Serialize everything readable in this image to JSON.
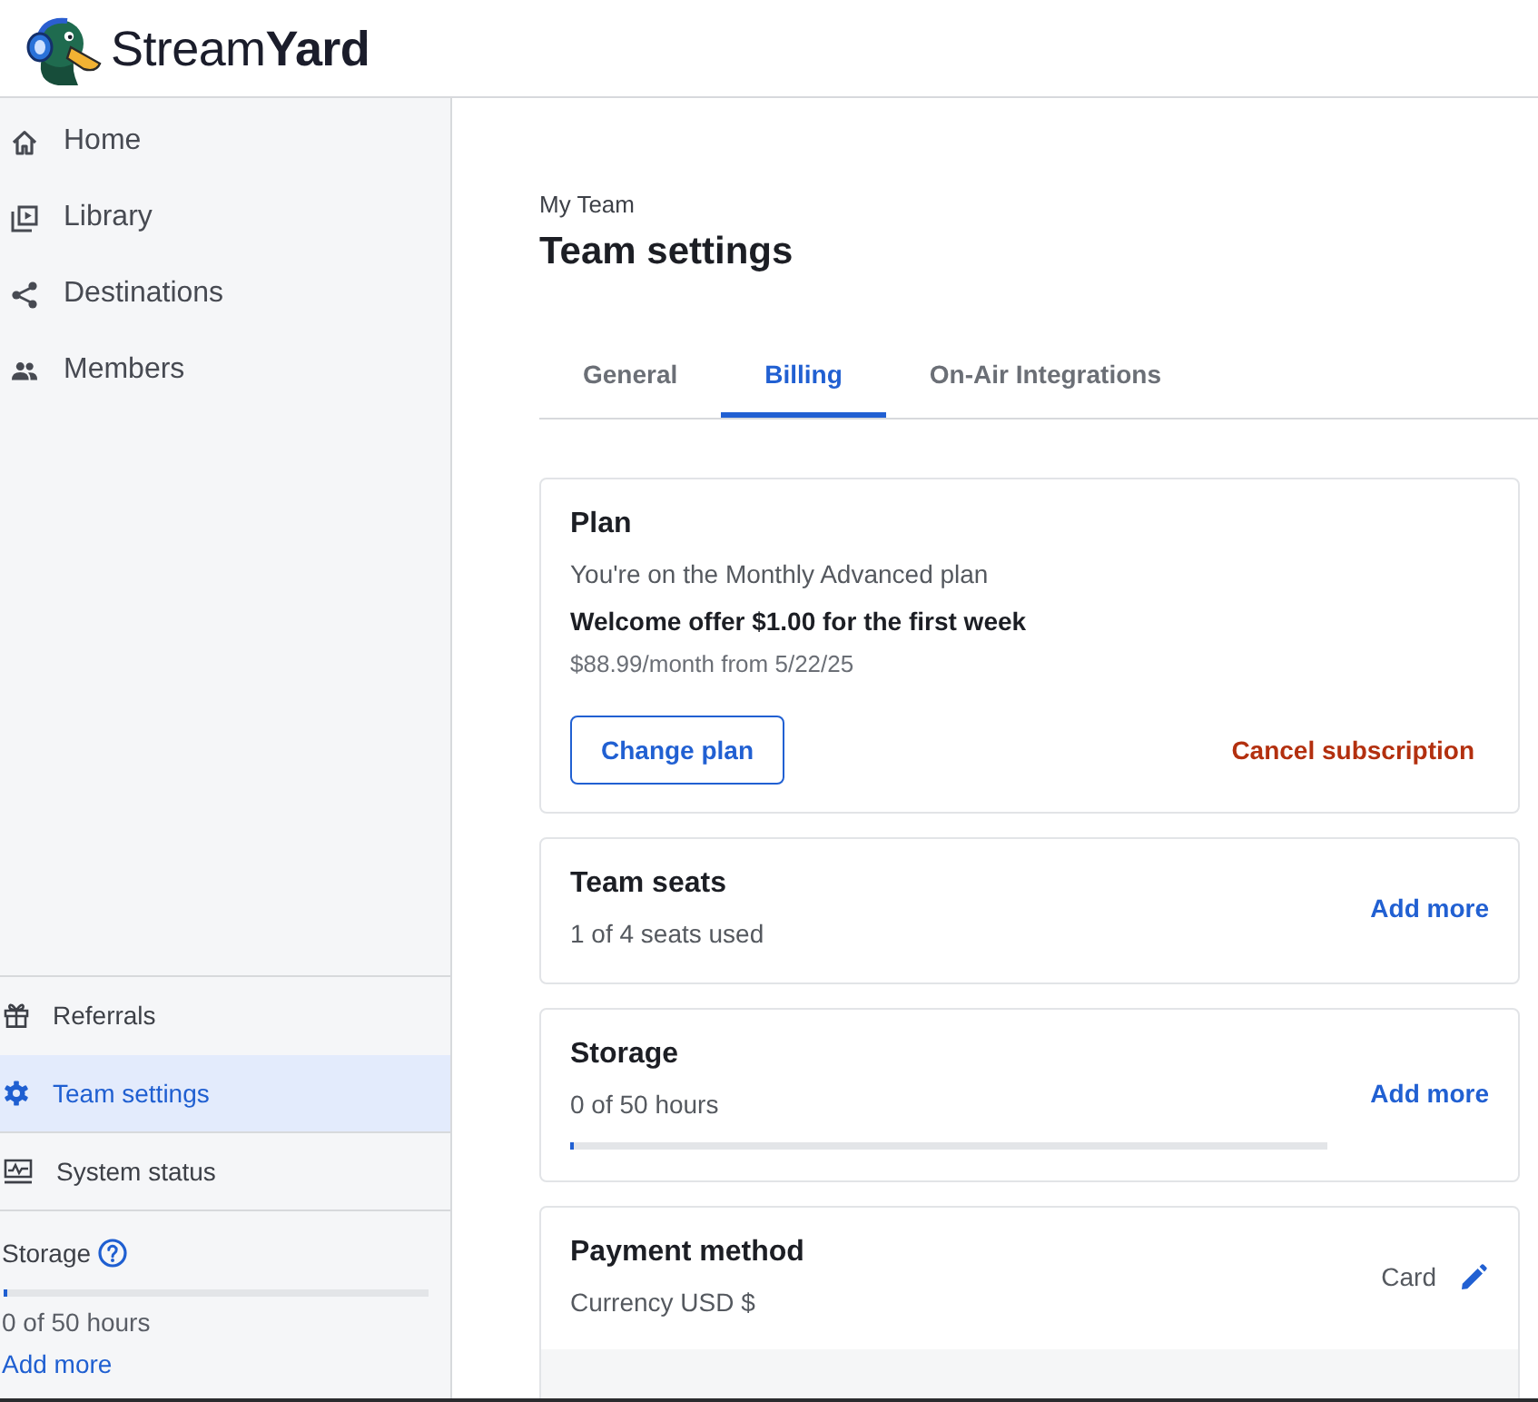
{
  "header": {
    "logo_text": "Stream**Yard**"
  },
  "sidebar": {
    "nav_items": [
      {
        "label": "Home",
        "selected": false
      },
      {
        "label": "Library",
        "selected": false
      },
      {
        "label": "Destinations",
        "selected": false
      },
      {
        "label": "Members",
        "selected": false
      }
    ],
    "bottom_items": [
      {
        "label": "Referrals",
        "selected": false
      },
      {
        "label": "Team settings",
        "selected": true
      },
      {
        "label": "System status",
        "selected": false
      }
    ],
    "storage": {
      "label": "Storage",
      "level": 0,
      "usage": "0 of 50 hours",
      "link": "Add more"
    }
  },
  "main": {
    "breadcrumb": "My Team",
    "title": "Team settings",
    "tabs": [
      {
        "label": "General",
        "selected": false
      },
      {
        "label": "Billing",
        "selected": true
      },
      {
        "label": "On-Air Integrations",
        "selected": false
      }
    ],
    "plan": {
      "title": "Plan",
      "description": "You're on the Monthly Advanced plan",
      "offer": "Welcome offer $1.00 for the first week",
      "price_note": "$88.99/month from 5/22/25",
      "change_button": "Change plan",
      "cancel_link": "Cancel subscription"
    },
    "team_seats": {
      "title": "Team seats",
      "usage": "1 of 4 seats used",
      "link": "Add more"
    },
    "storage": {
      "title": "Storage",
      "usage": "0 of 50 hours",
      "level": 0,
      "link": "Add more"
    },
    "payment_method": {
      "title": "Payment method",
      "currency": "Currency USD $",
      "method": "Card"
    }
  }
}
